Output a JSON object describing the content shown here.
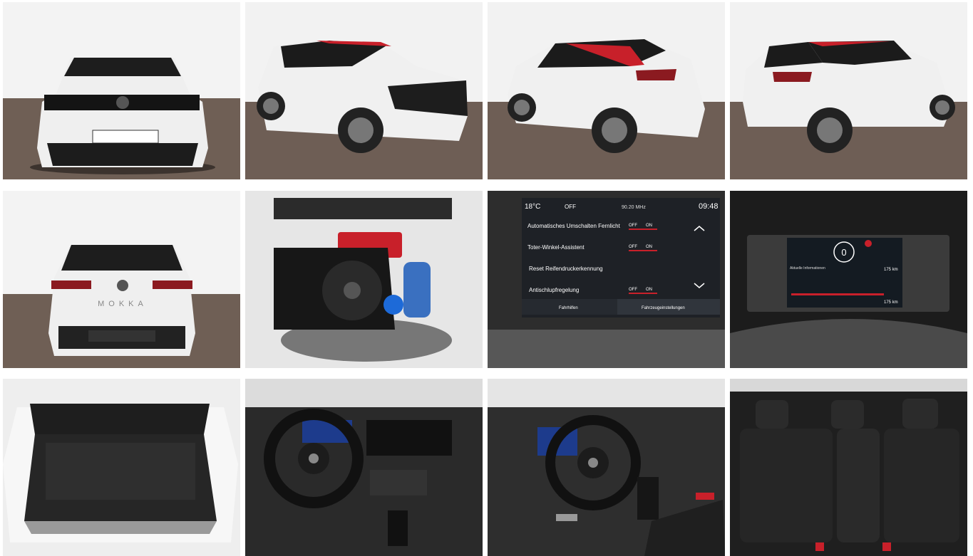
{
  "gallery": {
    "infotainment": {
      "temperature": "18°C",
      "ac_status": "OFF",
      "radio_freq": "90.20 MHz",
      "clock": "09:48",
      "rows": [
        {
          "label": "Automatisches Umschalten Fernlicht",
          "off": "OFF",
          "on": "ON"
        },
        {
          "label": "Toter-Winkel-Assistent",
          "off": "OFF",
          "on": "ON"
        },
        {
          "label": "Reset Reifendruckerkennung"
        },
        {
          "label": "Antischlupfregelung",
          "off": "OFF",
          "on": "ON"
        }
      ],
      "tabs": [
        "Fahrhilfen",
        "Fahrzeugeinstellungen"
      ]
    },
    "cluster": {
      "speed": "0",
      "info_title": "Aktuelle Informationen",
      "range_top": "175 km",
      "range_bottom": "175 km"
    },
    "rear_badge": "MOKKA",
    "colors": {
      "body_white": "#f2f2f2",
      "accent_red": "#c8202a",
      "floor_brown": "#6e5e55",
      "wall_white": "#f4f4f4",
      "dark_trim": "#2a2a2a"
    }
  }
}
